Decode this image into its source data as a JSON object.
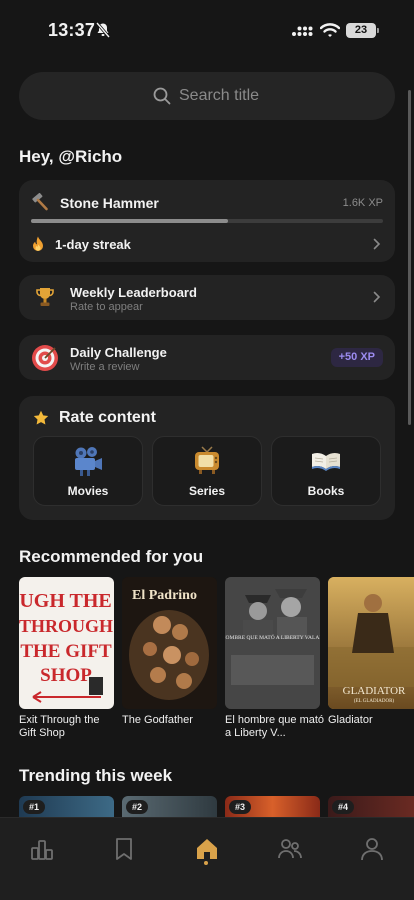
{
  "status_bar": {
    "time": "13:37",
    "battery": "23"
  },
  "search": {
    "placeholder": "Search title"
  },
  "greeting": "Hey, @Richo",
  "rank_card": {
    "rank_name": "Stone Hammer",
    "xp": "1.6K XP",
    "progress_fraction": 0.56,
    "streak": "1-day streak"
  },
  "leaderboard": {
    "title": "Weekly Leaderboard",
    "subtitle": "Rate to appear"
  },
  "daily_challenge": {
    "title": "Daily Challenge",
    "subtitle": "Write a review",
    "reward": "+50 XP"
  },
  "rate_content": {
    "title": "Rate content",
    "options": [
      {
        "label": "Movies",
        "icon": "film-camera-icon"
      },
      {
        "label": "Series",
        "icon": "tv-icon"
      },
      {
        "label": "Books",
        "icon": "open-book-icon"
      }
    ]
  },
  "recommended": {
    "title": "Recommended for you",
    "items": [
      {
        "title": "Exit Through the Gift Shop",
        "poster_text": "EXIT THROUGH THE GIFT SHOP"
      },
      {
        "title": "The Godfather",
        "poster_text": "El Padrino"
      },
      {
        "title": "El hombre que mató a Liberty V...",
        "poster_text": "EL HOMBRE QUE MATÓ A LIBERTY VALANCE"
      },
      {
        "title": "Gladiator",
        "poster_text": "GLADIATOR",
        "poster_subtext": "(EL GLADIADOR)"
      }
    ]
  },
  "trending": {
    "title": "Trending this week",
    "items": [
      {
        "rank": "#1"
      },
      {
        "rank": "#2"
      },
      {
        "rank": "#3"
      },
      {
        "rank": "#4"
      }
    ]
  },
  "tab_bar": {
    "tabs": [
      {
        "name": "stats",
        "icon": "bar-chart-icon"
      },
      {
        "name": "saved",
        "icon": "bookmark-icon"
      },
      {
        "name": "home",
        "icon": "home-icon",
        "active": true
      },
      {
        "name": "friends",
        "icon": "friends-icon"
      },
      {
        "name": "profile",
        "icon": "profile-icon"
      }
    ]
  },
  "colors": {
    "accent": "#d9a24a",
    "background": "#161616",
    "card": "#232323",
    "xp_badge": "#9c8cf0"
  }
}
